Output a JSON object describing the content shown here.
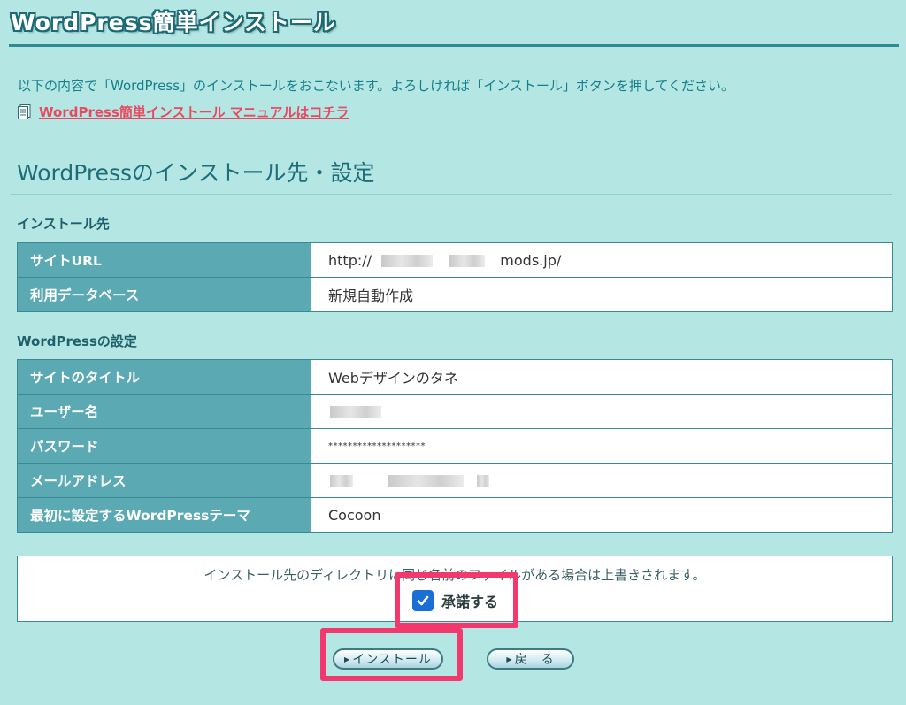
{
  "header": {
    "title": "WordPress簡単インストール"
  },
  "intro": {
    "text": "以下の内容で「WordPress」のインストールをおこないます。よろしければ「インストール」ボタンを押してください。"
  },
  "manual_link": {
    "label": "WordPress簡単インストール マニュアルはコチラ",
    "icon": "document-icon"
  },
  "section": {
    "title": "WordPressのインストール先・設定"
  },
  "install_target": {
    "heading": "インストール先",
    "rows": [
      {
        "label": "サイトURL",
        "value_prefix": "http://",
        "value_suffix": "mods.jp/"
      },
      {
        "label": "利用データベース",
        "value": "新規自動作成"
      }
    ]
  },
  "wp_settings": {
    "heading": "WordPressの設定",
    "rows": [
      {
        "label": "サイトのタイトル",
        "value": "Webデザインのタネ"
      },
      {
        "label": "ユーザー名",
        "value": ""
      },
      {
        "label": "パスワード",
        "value": "********************"
      },
      {
        "label": "メールアドレス",
        "value": ""
      },
      {
        "label": "最初に設定するWordPressテーマ",
        "value": "Cocoon"
      }
    ]
  },
  "notice": {
    "text": "インストール先のディレクトリに同じ名前のファイルがある場合は上書きされます。",
    "agree_label": "承諾する",
    "agree_checked": true
  },
  "buttons": {
    "install": "インストール",
    "back": "戻　る"
  },
  "colors": {
    "background": "#b4e6e4",
    "accent": "#2e8b96",
    "label_cell": "#5aa9b3",
    "link": "#e8495f",
    "highlight": "#f2386d",
    "checkbox": "#1a6fd6"
  }
}
